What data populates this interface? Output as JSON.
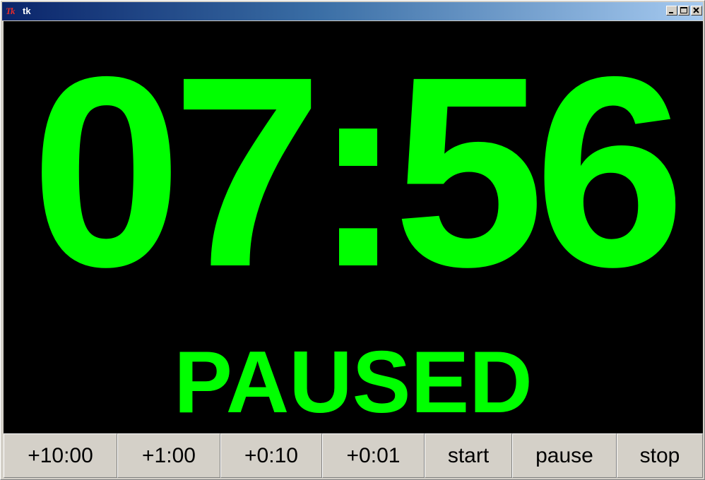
{
  "window": {
    "title": "tk",
    "logo_text": "Tk"
  },
  "timer": {
    "time": "07:56",
    "status": "PAUSED",
    "color": "#00ff00",
    "background": "#000000"
  },
  "buttons": [
    {
      "label": "+10:00"
    },
    {
      "label": "+1:00"
    },
    {
      "label": "+0:10"
    },
    {
      "label": "+0:01"
    },
    {
      "label": "start"
    },
    {
      "label": "pause"
    },
    {
      "label": "stop"
    }
  ]
}
